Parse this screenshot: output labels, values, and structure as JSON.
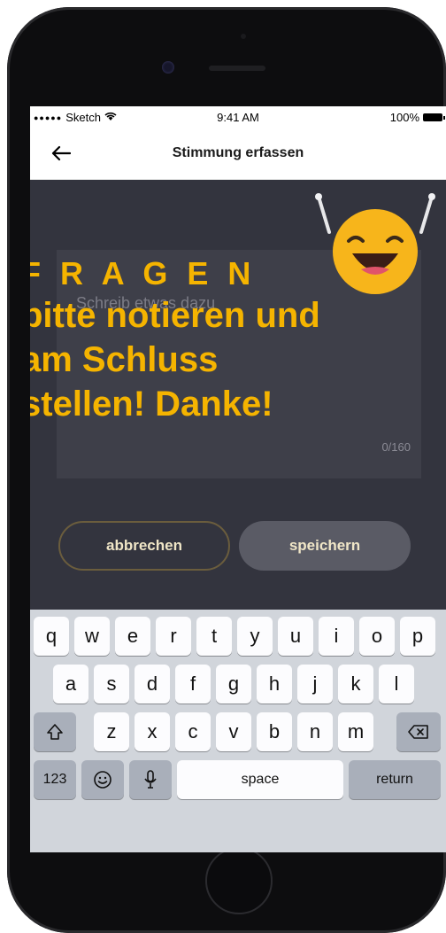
{
  "status_bar": {
    "carrier": "Sketch",
    "time": "9:41 AM",
    "battery": "100%"
  },
  "nav": {
    "title": "Stimmung erfassen"
  },
  "textarea": {
    "placeholder": "Schreib etwas dazu",
    "counter": "0/160"
  },
  "overlay": {
    "line1": "F R A G E N",
    "line2": "bitte notieren und",
    "line3": "am Schluss",
    "line4": "stellen! Danke!"
  },
  "buttons": {
    "cancel": "abbrechen",
    "save": "speichern"
  },
  "keyboard": {
    "row1": [
      "q",
      "w",
      "e",
      "r",
      "t",
      "y",
      "u",
      "i",
      "o",
      "p"
    ],
    "row2": [
      "a",
      "s",
      "d",
      "f",
      "g",
      "h",
      "j",
      "k",
      "l"
    ],
    "row3": [
      "z",
      "x",
      "c",
      "v",
      "b",
      "n",
      "m"
    ],
    "numbers_key": "123",
    "space": "space",
    "return": "return"
  },
  "colors": {
    "accent": "#f5b400",
    "screen_bg": "#33343e",
    "keyboard_bg": "#d1d5db"
  }
}
